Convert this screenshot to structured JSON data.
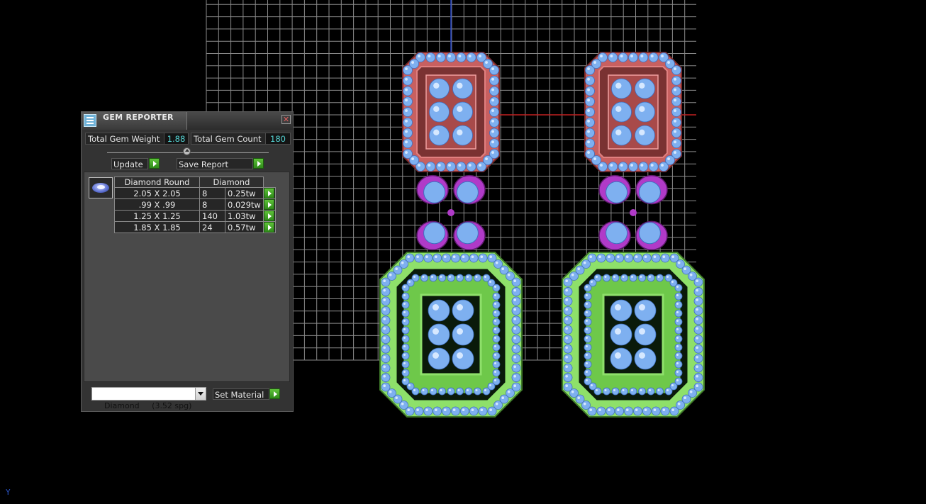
{
  "panel": {
    "title": "GEM REPORTER",
    "close_symbol": "✕",
    "icons": {
      "app": "gem-reporter-icon",
      "close": "close-icon",
      "action": "play-arrow-icon",
      "thumbnail": "diamond-round-icon"
    },
    "total_weight_label": "Total Gem Weight",
    "total_weight_value": "1.88",
    "total_count_label": "Total Gem Count",
    "total_count_value": "180",
    "update_label": "Update",
    "save_report_label": "Save Report",
    "table": {
      "headers": [
        "Diamond Round",
        "Diamond"
      ],
      "rows": [
        {
          "size": "2.05 X 2.05",
          "count": "8",
          "weight": "0.25tw"
        },
        {
          "size": ".99 X .99",
          "count": "8",
          "weight": "0.029tw"
        },
        {
          "size": "1.25 X 1.25",
          "count": "140",
          "weight": "1.03tw"
        },
        {
          "size": "1.85 X 1.85",
          "count": "24",
          "weight": "0.57tw"
        }
      ]
    },
    "material_select": "Diamond     (3.52 spg)",
    "set_material_label": "Set Material"
  },
  "viewport": {
    "axis_label": "Y",
    "colors": {
      "background": "#000000",
      "grid": "#8a8a8a",
      "axis_vertical": "#2545c8",
      "axis_horizontal": "#c02020",
      "gem": "#7eb0f0",
      "top_metal": "#c86060",
      "middle_metal": "#b03ac8",
      "bottom_metal": "#8ee06a"
    }
  },
  "colors": {
    "panel_bg": "#333333",
    "value_text": "#55d6d6",
    "button_green": "#3fa020"
  }
}
